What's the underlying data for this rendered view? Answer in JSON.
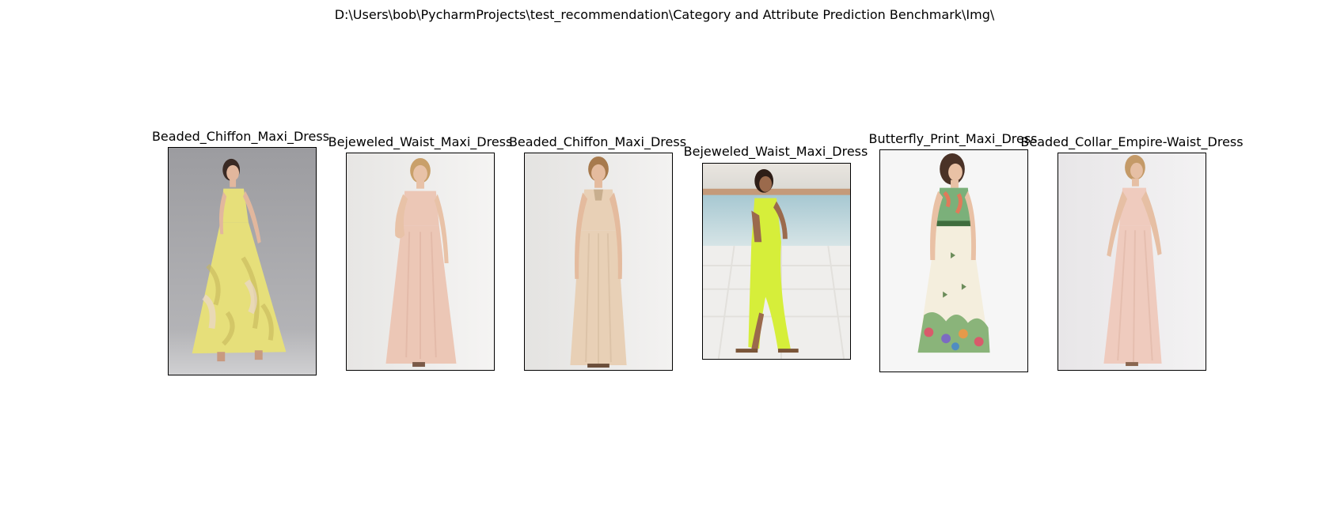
{
  "figure": {
    "title": "D:\\Users\\bob\\PycharmProjects\\test_recommendation\\Category and Attribute Prediction Benchmark\\Img\\"
  },
  "panels": [
    {
      "title": "Beaded_Chiffon_Maxi_Dress",
      "photo": "woman in yellow floral chiffon halter maxi dress",
      "dress_color": "#e6df7a",
      "bg_color": "#a9a9ad"
    },
    {
      "title": "Bejeweled_Waist_Maxi_Dress",
      "photo": "woman in blush halter maxi dress",
      "dress_color": "#ecc7b6",
      "bg_color": "#f0efee"
    },
    {
      "title": "Beaded_Chiffon_Maxi_Dress",
      "photo": "woman in beige beaded halter maxi dress",
      "dress_color": "#e8d0b6",
      "bg_color": "#f0efee"
    },
    {
      "title": "Bejeweled_Waist_Maxi_Dress",
      "photo": "woman in neon yellow-green maxi dress on beach",
      "dress_color": "#d6ee3a",
      "bg_color": "#bcd3db"
    },
    {
      "title": "Butterfly_Print_Maxi_Dress",
      "photo": "woman in cream floral print maxi dress",
      "dress_color": "#f4eedd",
      "bg_color": "#f5f5f5"
    },
    {
      "title": "Beaded_Collar_Empire-Waist_Dress",
      "photo": "woman in blush empire-waist maxi dress, side view",
      "dress_color": "#efcbbe",
      "bg_color": "#efedef"
    }
  ]
}
